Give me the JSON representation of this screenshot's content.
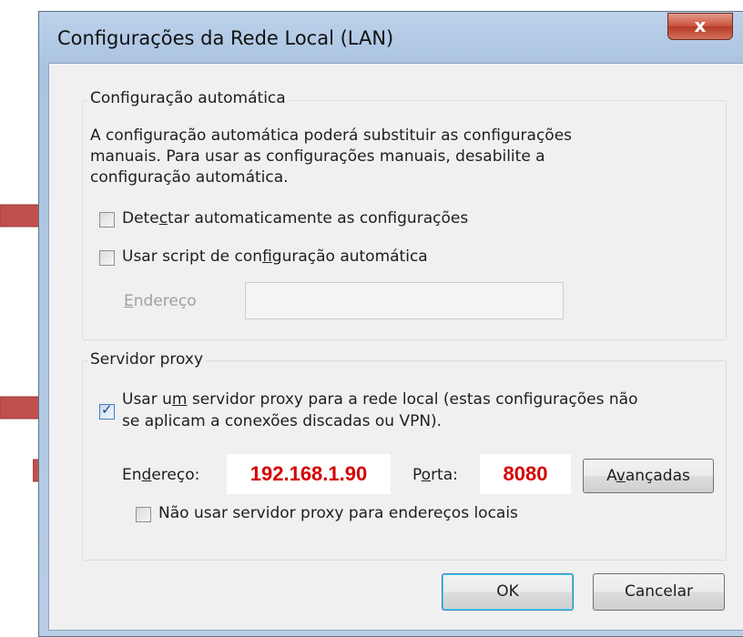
{
  "window": {
    "title": "Configurações da Rede Local (LAN)",
    "close_glyph": "x"
  },
  "auto_config": {
    "legend": "Configuração automática",
    "description": "A configuração automática poderá substituir as configurações manuais. Para usar as configurações manuais, desabilite a configuração automática.",
    "detect": {
      "pre": "Dete",
      "key": "c",
      "post": "tar automaticamente as configurações",
      "checked": false
    },
    "script": {
      "pre": "Usar script de con",
      "key": "f",
      "post": "iguração automática",
      "checked": false
    },
    "address": {
      "pre": "",
      "key": "E",
      "post": "ndereço",
      "value": "",
      "enabled": false
    }
  },
  "proxy": {
    "legend": "Servidor proxy",
    "use_proxy": {
      "pre": "Usar u",
      "key": "m",
      "post": " servidor proxy para a rede local (estas configurações não",
      "line2": "se aplicam a conexões discadas ou VPN).",
      "checked": true
    },
    "address": {
      "pre": "En",
      "key": "d",
      "post": "ereço:",
      "value": "192.168.1.90"
    },
    "port": {
      "pre": "P",
      "key": "o",
      "post": "rta:",
      "value": "8080"
    },
    "advanced": {
      "pre": "A",
      "key": "v",
      "post": "ançadas"
    },
    "bypass": {
      "label": "Não usar servidor proxy para endereços locais",
      "checked": false
    }
  },
  "buttons": {
    "ok": "OK",
    "cancel": "Cancelar"
  },
  "annotation": {
    "arrow_color": "#c0504d"
  }
}
